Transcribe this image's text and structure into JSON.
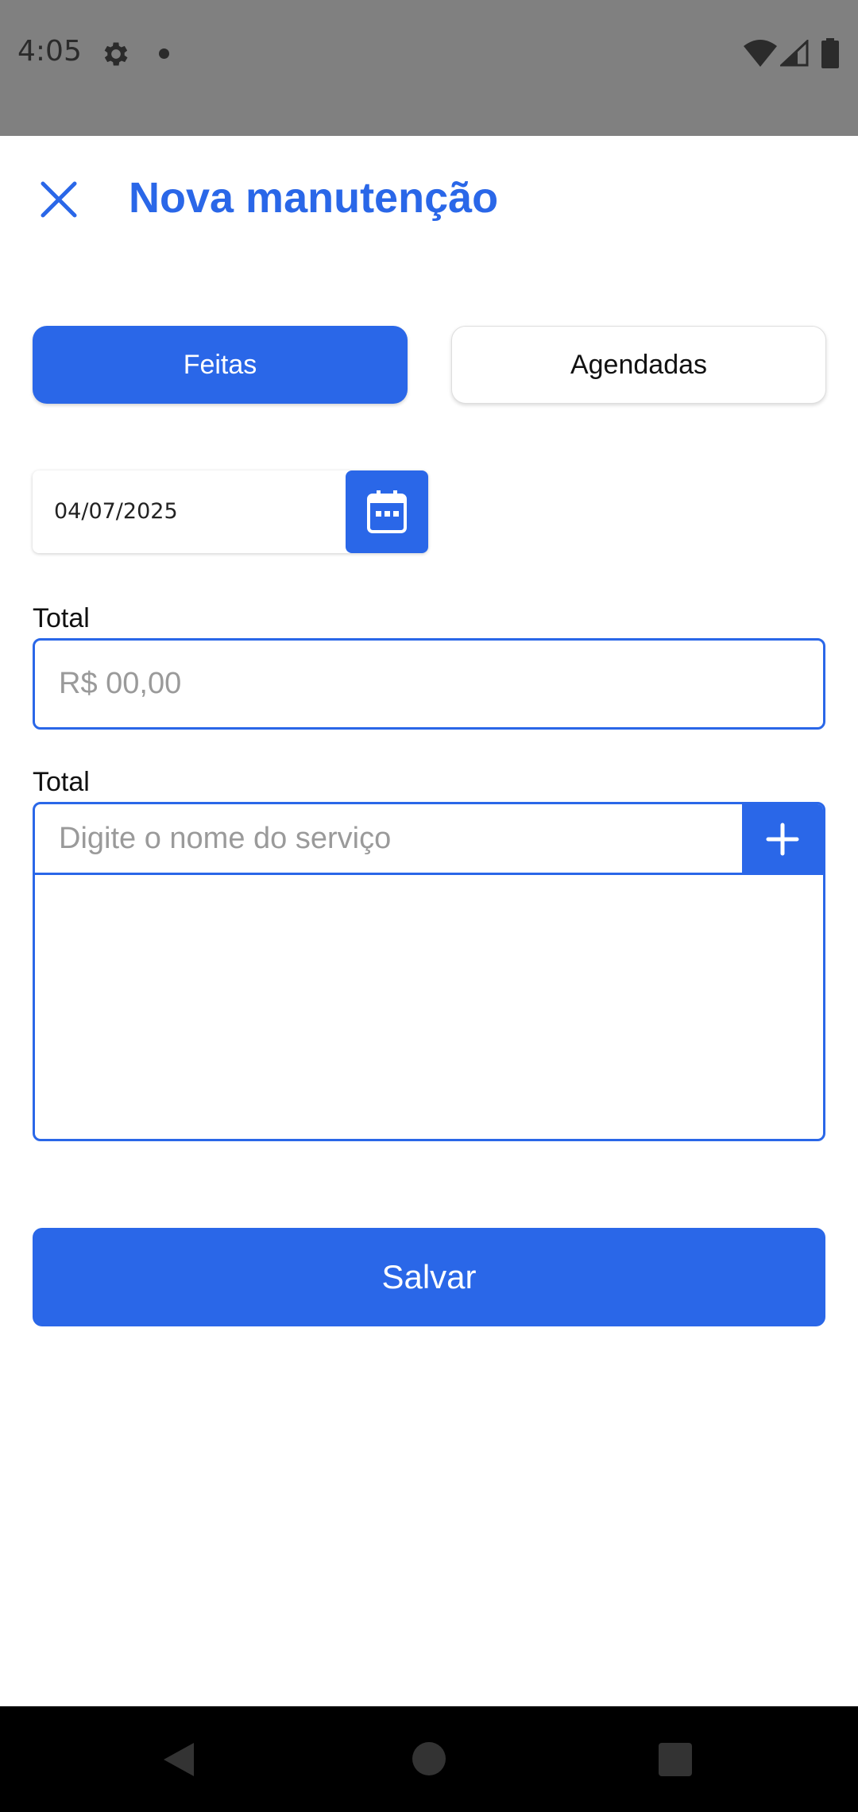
{
  "status_bar": {
    "time": "4:05",
    "icons": [
      "gear-icon",
      "notification-dot-icon",
      "wifi-icon",
      "signal-icon",
      "battery-icon"
    ]
  },
  "header": {
    "title": "Nova manutenção",
    "close_icon": "close-icon"
  },
  "tabs": [
    {
      "label": "Feitas",
      "selected": true
    },
    {
      "label": "Agendadas",
      "selected": false
    }
  ],
  "date_picker": {
    "value": "04/07/2025",
    "icon": "calendar-icon"
  },
  "total_field": {
    "label": "Total",
    "value": "",
    "placeholder": "R$ 00,00"
  },
  "service_field": {
    "label": "Total",
    "value": "",
    "placeholder": "Digite o nome do serviço",
    "add_icon": "plus-icon",
    "items": []
  },
  "save_button": {
    "label": "Salvar"
  },
  "colors": {
    "accent": "#2a67e8",
    "status_bar": "#808080",
    "nav_bar": "#000000"
  }
}
